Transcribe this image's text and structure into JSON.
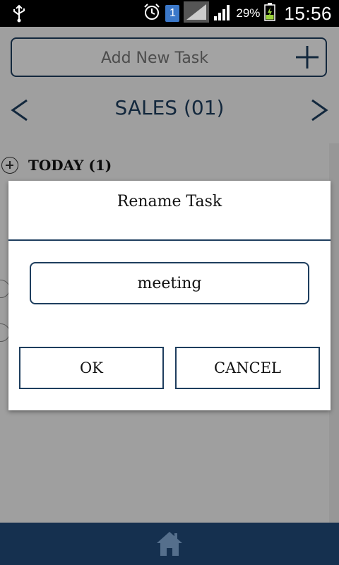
{
  "statusbar": {
    "battery_percent": "29%",
    "time": "15:56",
    "sim_slot": "1"
  },
  "app": {
    "add_task_placeholder": "Add New Task",
    "list_title": "SALES (01)",
    "section_label": "TODAY (1)"
  },
  "dialog": {
    "title": "Rename Task",
    "input_value": "meeting",
    "ok_label": "OK",
    "cancel_label": "CANCEL"
  },
  "colors": {
    "accent": "#1e3e5e",
    "bottom_bar": "#15304f"
  }
}
